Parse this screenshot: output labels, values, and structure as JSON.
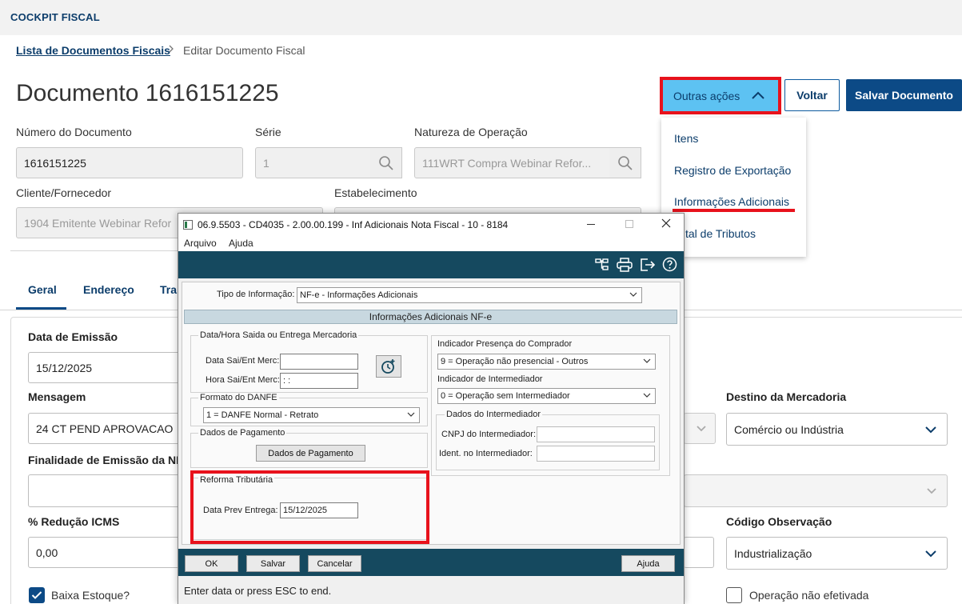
{
  "app": {
    "title": "COCKPIT FISCAL"
  },
  "breadcrumb": {
    "parent": "Lista de Documentos Fiscais",
    "current": "Editar Documento Fiscal"
  },
  "page": {
    "title": "Documento 1616151225"
  },
  "actions": {
    "outras_label": "Outras ações",
    "voltar_label": "Voltar",
    "salvar_label": "Salvar Documento",
    "menu_items": [
      "Itens",
      "Registro de Exportação",
      "Informações Adicionais",
      "Total de Tributos"
    ],
    "menu_item_visible_text": "tal de Tributos"
  },
  "form": {
    "numero": {
      "label": "Número do Documento",
      "value": "1616151225"
    },
    "serie": {
      "label": "Série",
      "value": "1"
    },
    "natureza": {
      "label": "Natureza de Operação",
      "value": "111WRT  Compra Webinar Refor..."
    },
    "cliente": {
      "label": "Cliente/Fornecedor",
      "value": "1904  Emitente Webinar Refor"
    },
    "estabelecimento": {
      "label": "Estabelecimento"
    }
  },
  "tabs": [
    "Geral",
    "Endereço",
    "Tra"
  ],
  "geral": {
    "data_emissao": {
      "label": "Data de Emissão",
      "value": "15/12/2025"
    },
    "mensagem": {
      "label": "Mensagem",
      "value": "24  CT PEND  APROVACAO"
    },
    "finalidade": {
      "label": "Finalidade de Emissão da NF-"
    },
    "reducao_icms": {
      "label": "% Redução ICMS",
      "value": "0,00"
    },
    "baixa_estoque": {
      "label": "Baixa Estoque?",
      "checked": true
    },
    "destino": {
      "label": "Destino da Mercadoria",
      "value": "Comércio ou Indústria"
    },
    "codigo_obs": {
      "label": "Código Observação",
      "value": "Industrialização"
    },
    "operacao_nao_efetivada": {
      "label": "Operação não efetivada",
      "checked": false
    }
  },
  "dialog": {
    "title": "06.9.5503 - CD4035 - 2.00.00.199 - Inf Adicionais Nota Fiscal - 10 - 8184",
    "menu": [
      "Arquivo",
      "Ajuda"
    ],
    "tipo_info": {
      "label": "Tipo de Informação:",
      "value": "NF-e - Informações Adicionais"
    },
    "section_title": "Informações Adicionais NF-e",
    "datahora_group": "Data/Hora Saida ou Entrega Mercadoria",
    "data_sai_label": "Data Sai/Ent Merc:",
    "data_sai_value": "",
    "hora_sai_label": "Hora Sai/Ent Merc:",
    "hora_sai_value": " :  :",
    "formato_danfe": {
      "label": "Formato do DANFE",
      "value": "1 = DANFE Normal - Retrato"
    },
    "dados_pagamento": {
      "label": "Dados de Pagamento",
      "button": "Dados de Pagamento"
    },
    "reforma": {
      "label": "Reforma Tributária",
      "data_prev_label": "Data Prev Entrega:",
      "data_prev_value": "15/12/2025"
    },
    "presenca": {
      "label": "Indicador Presença do Comprador",
      "value": "9 = Operação não presencial - Outros"
    },
    "intermediador": {
      "label": "Indicador de Intermediador",
      "value": "0 = Operação sem Intermediador"
    },
    "dados_intermediador": {
      "label": "Dados do Intermediador",
      "cnpj_label": "CNPJ do Intermediador:",
      "ident_label": "Ident. no Intermediador:"
    },
    "buttons": {
      "ok": "OK",
      "salvar": "Salvar",
      "cancelar": "Cancelar",
      "ajuda": "Ajuda"
    },
    "status": "Enter data or press ESC to end."
  },
  "colors": {
    "primary": "#0c4a86",
    "accent": "#5dc2f2",
    "highlight": "#e8121c",
    "dialog_bar": "#15495f"
  }
}
